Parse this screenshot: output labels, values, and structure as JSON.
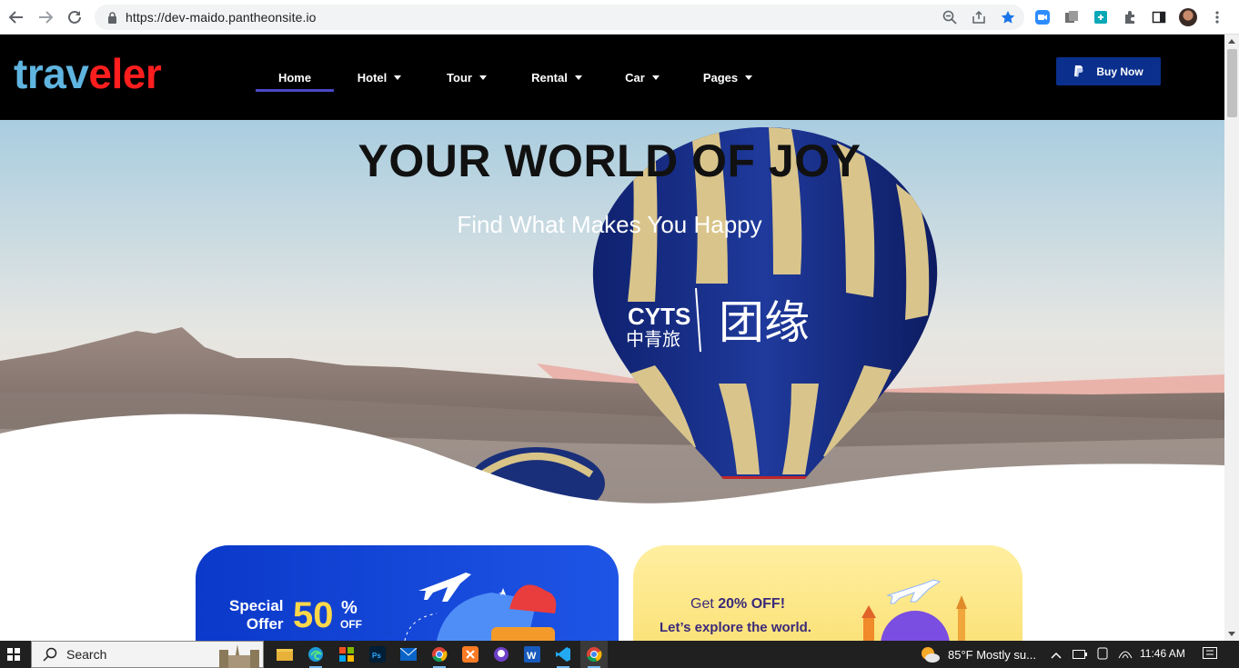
{
  "browser": {
    "url": "https://dev-maido.pantheonsite.io",
    "back_icon": "arrow-left-icon",
    "forward_icon": "arrow-right-icon",
    "reload_icon": "reload-icon"
  },
  "site": {
    "logo_part1": "trav",
    "logo_part2": "eler",
    "menu": [
      {
        "label": "Home",
        "active": true
      },
      {
        "label": "Hotel"
      },
      {
        "label": "Tour"
      },
      {
        "label": "Rental"
      },
      {
        "label": "Car"
      },
      {
        "label": "Pages"
      }
    ],
    "buy_now": "Buy Now",
    "colors": {
      "accent": "#4a47c8",
      "buy_button": "#0a2f8c",
      "logo_blue": "#5fb4e0",
      "logo_red": "#ff1e1e"
    }
  },
  "hero": {
    "title": "YOUR WORLD OF JOY",
    "subtitle": "Find What Makes You Happy",
    "balloon_text_1": "CYTS",
    "balloon_text_2": "中青旅",
    "balloon_text_3": "团缘"
  },
  "promos": [
    {
      "line1": "Special",
      "line2": "Offer",
      "big": "50",
      "pct": "%",
      "off": "OFF"
    },
    {
      "prefix": "Get ",
      "bold": "20% OFF!",
      "line2": "Let’s explore the world."
    }
  ],
  "taskbar": {
    "search": "Search",
    "weather": "85°F  Mostly su...",
    "time": "11:46 AM"
  }
}
